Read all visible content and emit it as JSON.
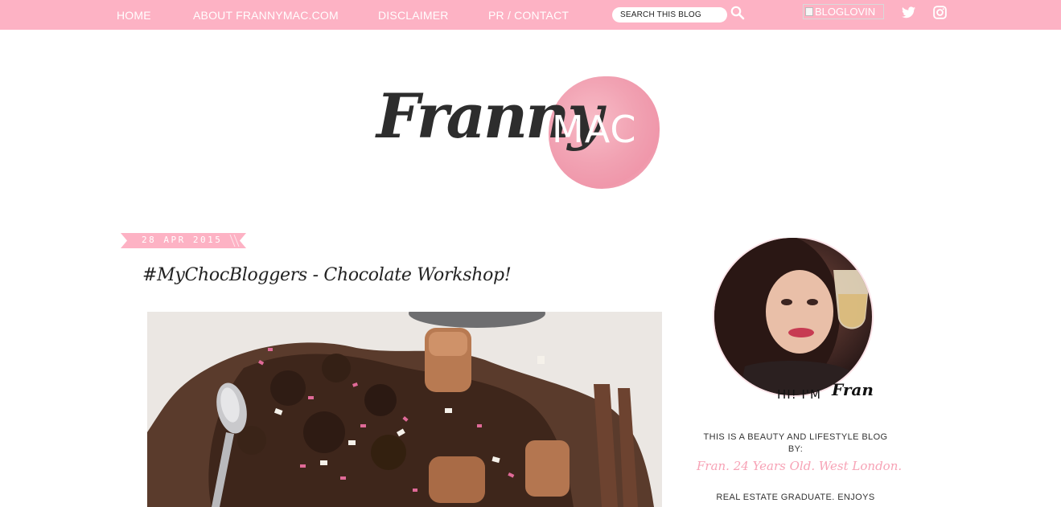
{
  "nav": {
    "items": [
      {
        "label": "HOME"
      },
      {
        "label": "ABOUT FRANNYMAC.COM"
      },
      {
        "label": "DISCLAIMER"
      },
      {
        "label": "PR / CONTACT"
      }
    ],
    "search": {
      "placeholder": "SEARCH THIS BLOG"
    },
    "bloglovin_alt": "BLOGLOVIN",
    "social_icons": [
      "twitter-icon",
      "instagram-icon"
    ],
    "accent_color": "#fdb2c4"
  },
  "logo": {
    "script_text": "Franny",
    "mac_text": "MAC"
  },
  "post": {
    "date": "28 APR 2015",
    "title": "#MyChocBloggers - Chocolate Workshop!"
  },
  "sidebar": {
    "profile_caption_prefix": "HI! I'M",
    "profile_caption_name": "Fran",
    "intro_line1": "THIS IS A BEAUTY AND LIFESTYLE BLOG BY:",
    "intro_line2": "Fran. 24 Years Old. West London.",
    "intro_line3": "REAL ESTATE GRADUATE. ENJOYS"
  }
}
